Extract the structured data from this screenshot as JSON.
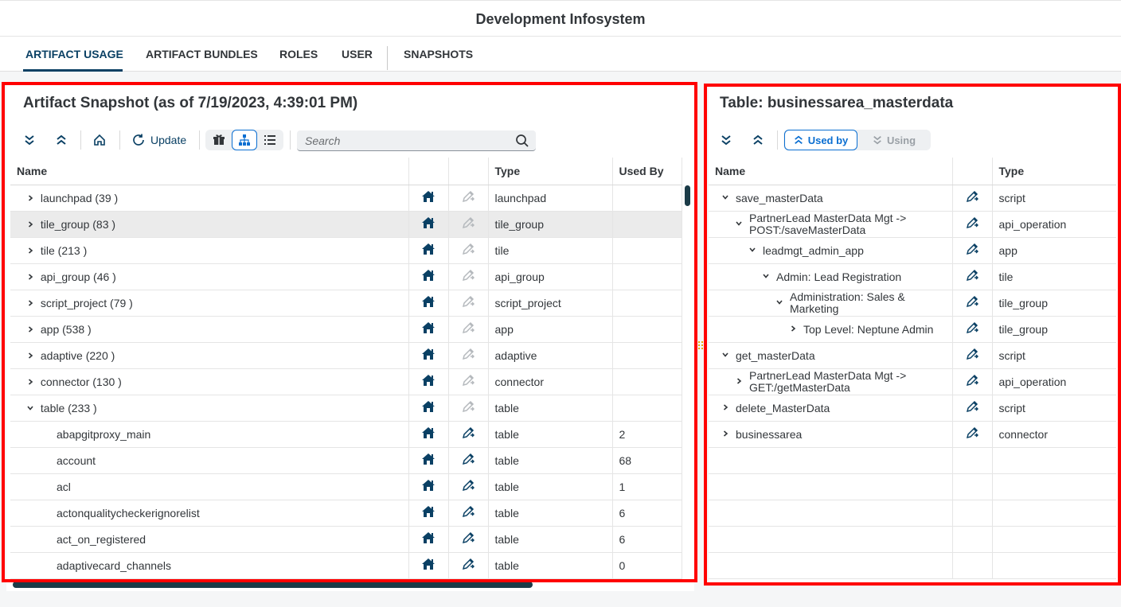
{
  "header": {
    "title": "Development Infosystem"
  },
  "tabs": [
    {
      "label": "ARTIFACT USAGE",
      "active": true
    },
    {
      "label": "ARTIFACT BUNDLES"
    },
    {
      "label": "ROLES"
    },
    {
      "label": "USER"
    },
    {
      "label": "SNAPSHOTS"
    }
  ],
  "left": {
    "title": "Artifact Snapshot (as of 7/19/2023, 4:39:01 PM)",
    "toolbar": {
      "update_label": "Update"
    },
    "search": {
      "placeholder": "Search"
    },
    "columns": {
      "name": "Name",
      "type": "Type",
      "used_by": "Used By"
    },
    "rows": [
      {
        "name": "launchpad (39 )",
        "type": "launchpad",
        "used_by": "",
        "level": 0,
        "chevron": "right"
      },
      {
        "name": "tile_group (83 )",
        "type": "tile_group",
        "used_by": "",
        "level": 0,
        "chevron": "right",
        "highlight": true
      },
      {
        "name": "tile (213 )",
        "type": "tile",
        "used_by": "",
        "level": 0,
        "chevron": "right"
      },
      {
        "name": "api_group (46 )",
        "type": "api_group",
        "used_by": "",
        "level": 0,
        "chevron": "right"
      },
      {
        "name": "script_project (79 )",
        "type": "script_project",
        "used_by": "",
        "level": 0,
        "chevron": "right"
      },
      {
        "name": "app (538 )",
        "type": "app",
        "used_by": "",
        "level": 0,
        "chevron": "right"
      },
      {
        "name": "adaptive (220 )",
        "type": "adaptive",
        "used_by": "",
        "level": 0,
        "chevron": "right"
      },
      {
        "name": "connector (130 )",
        "type": "connector",
        "used_by": "",
        "level": 0,
        "chevron": "right"
      },
      {
        "name": "table (233 )",
        "type": "table",
        "used_by": "",
        "level": 0,
        "chevron": "down"
      },
      {
        "name": "abapgitproxy_main",
        "type": "table",
        "used_by": "2",
        "level": 1,
        "chevron": ""
      },
      {
        "name": "account",
        "type": "table",
        "used_by": "68",
        "level": 1,
        "chevron": ""
      },
      {
        "name": "acl",
        "type": "table",
        "used_by": "1",
        "level": 1,
        "chevron": ""
      },
      {
        "name": "actonqualitycheckerignorelist",
        "type": "table",
        "used_by": "6",
        "level": 1,
        "chevron": ""
      },
      {
        "name": "act_on_registered",
        "type": "table",
        "used_by": "6",
        "level": 1,
        "chevron": ""
      },
      {
        "name": "adaptivecard_channels",
        "type": "table",
        "used_by": "0",
        "level": 1,
        "chevron": ""
      }
    ]
  },
  "right": {
    "title": "Table: businessarea_masterdata",
    "segments": {
      "used_by": "Used by",
      "using": "Using"
    },
    "columns": {
      "name": "Name",
      "type": "Type"
    },
    "rows": [
      {
        "name": "save_masterData",
        "type": "script",
        "indent": 0,
        "chevron": "down"
      },
      {
        "name": "PartnerLead MasterData Mgt -> POST:/saveMasterData",
        "type": "api_operation",
        "indent": 1,
        "chevron": "down"
      },
      {
        "name": "leadmgt_admin_app",
        "type": "app",
        "indent": 2,
        "chevron": "down"
      },
      {
        "name": "Admin: Lead Registration",
        "type": "tile",
        "indent": 3,
        "chevron": "down"
      },
      {
        "name": "Administration: Sales & Marketing",
        "type": "tile_group",
        "indent": 4,
        "chevron": "down"
      },
      {
        "name": "Top Level: Neptune Admin",
        "type": "tile_group",
        "indent": 5,
        "chevron": "right"
      },
      {
        "name": "get_masterData",
        "type": "script",
        "indent": 0,
        "chevron": "down"
      },
      {
        "name": "PartnerLead MasterData Mgt -> GET:/getMasterData",
        "type": "api_operation",
        "indent": 1,
        "chevron": "right"
      },
      {
        "name": "delete_MasterData",
        "type": "script",
        "indent": 0,
        "chevron": "right"
      },
      {
        "name": "businessarea",
        "type": "connector",
        "indent": 0,
        "chevron": "right"
      }
    ]
  }
}
